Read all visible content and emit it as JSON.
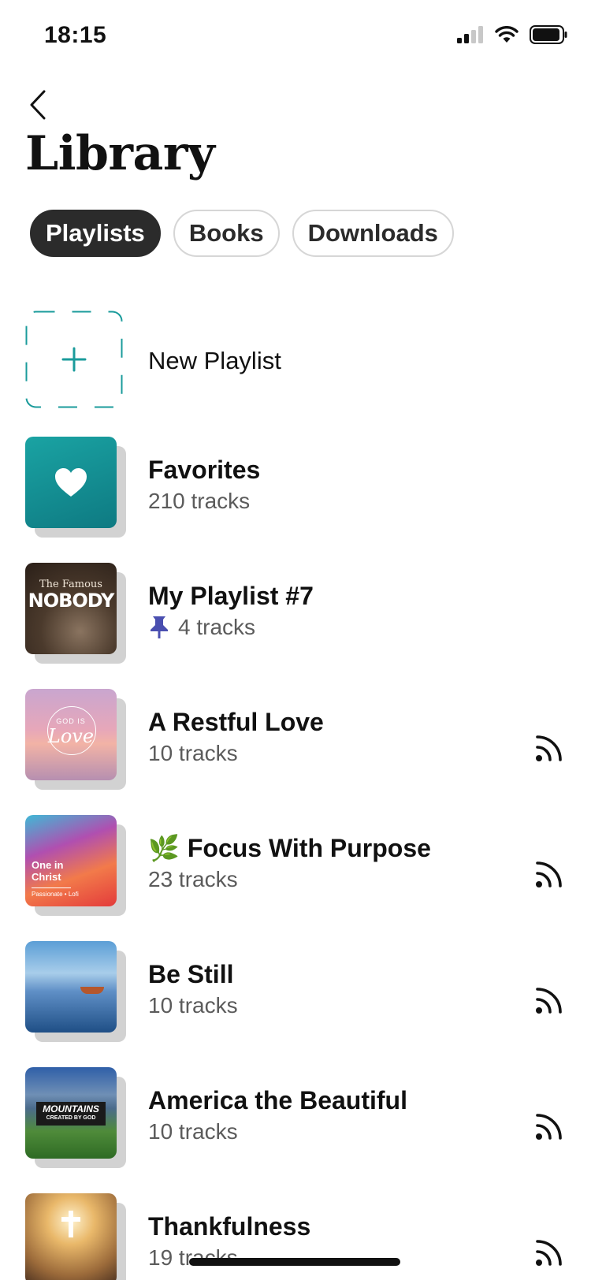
{
  "status": {
    "time": "18:15"
  },
  "header": {
    "title": "Library"
  },
  "tabs": [
    {
      "label": "Playlists",
      "active": true
    },
    {
      "label": "Books",
      "active": false
    },
    {
      "label": "Downloads",
      "active": false
    }
  ],
  "new_playlist": {
    "label": "New Playlist"
  },
  "playlists": [
    {
      "title": "Favorites",
      "subtitle": "210 tracks",
      "cover_icon": "heart-icon"
    },
    {
      "title": "My Playlist #7",
      "subtitle": "4 tracks",
      "cover_text_top": "The Famous",
      "cover_text_main": "NOBODY",
      "pinned": true
    },
    {
      "title": "A Restful Love",
      "subtitle": "10 tracks",
      "cover_text_top": "GOD IS",
      "cover_text_main": "Love",
      "cast": true
    },
    {
      "title": "Focus With Purpose",
      "subtitle": "23 tracks",
      "emoji": "🌿",
      "cover_text_main": "One in Christ",
      "cover_text_bottom": "Passionate • Lofi",
      "cast": true
    },
    {
      "title": "Be Still",
      "subtitle": "10 tracks",
      "cast": true
    },
    {
      "title": "America the Beautiful",
      "subtitle": "10 tracks",
      "cover_text_main": "MOUNTAINS",
      "cover_text_bottom": "CREATED BY GOD",
      "cast": true
    },
    {
      "title": "Thankfulness",
      "subtitle": "19 tracks",
      "cast": true
    }
  ],
  "colors": {
    "accent": "#1a9b9b",
    "pin": "#4a4fb0",
    "active_tab": "#2b2b2b"
  }
}
